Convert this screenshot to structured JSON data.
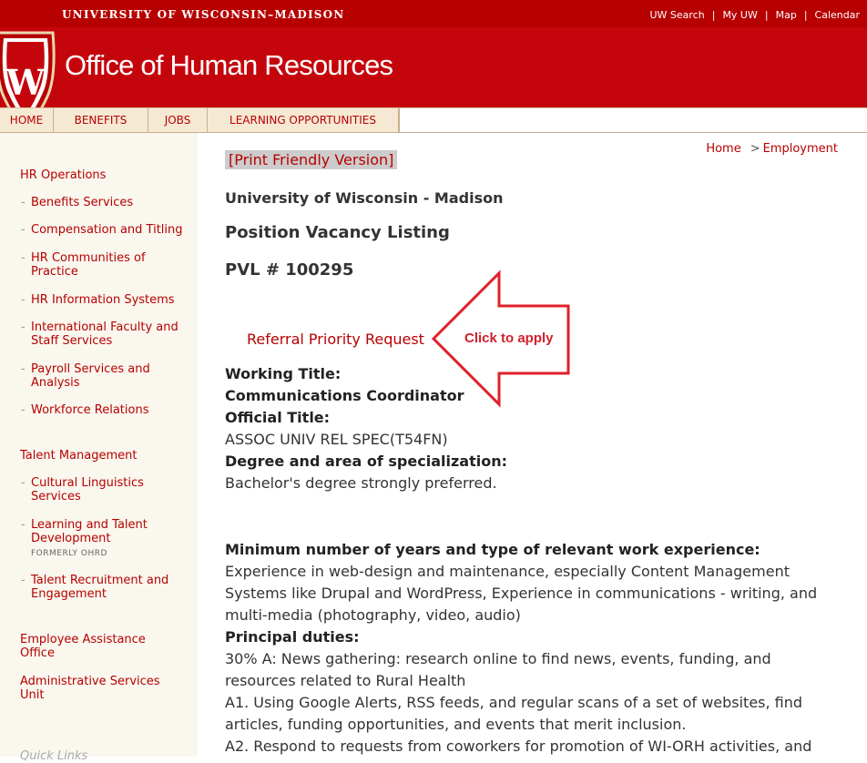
{
  "header": {
    "university": "UNIVERSITY OF WISCONSIN–MADISON",
    "office": "Office of Human Resources",
    "crest_letter": "W",
    "top_links": [
      "UW Search",
      "My UW",
      "Map",
      "Calendar"
    ]
  },
  "nav": {
    "tabs": [
      "HOME",
      "BENEFITS",
      "JOBS",
      "LEARNING OPPORTUNITIES"
    ]
  },
  "sidebar": {
    "hr_operations": "HR Operations",
    "hr_items": [
      "Benefits Services",
      "Compensation and Titling",
      "HR Communities of Practice",
      "HR Information Systems",
      "International Faculty and Staff Services",
      "Payroll Services and Analysis",
      "Workforce Relations"
    ],
    "talent_management": "Talent Management",
    "talent_items": [
      "Cultural Linguistics Services",
      "Learning and Talent Development",
      "Talent Recruitment and Engagement"
    ],
    "talent_note": "FORMERLY OHRD",
    "employee_assistance": "Employee Assistance Office",
    "administrative_services": "Administrative Services Unit",
    "quick_links": "Quick Links"
  },
  "breadcrumb": {
    "home": "Home",
    "gt": ">",
    "current": "Employment"
  },
  "content": {
    "print_label": "[Print Friendly Version]",
    "university_title": "University of Wisconsin - Madison",
    "listing_title": "Position Vacancy Listing",
    "pvl": "PVL # 100295",
    "referral_link": "Referral Priority Request",
    "click_to_apply": "Click to apply",
    "working_title_label": "Working Title:",
    "working_title": "Communications Coordinator",
    "official_title_label": "Official Title:",
    "official_title": "ASSOC UNIV REL SPEC(T54FN)",
    "degree_label": "Degree and area of specialization:",
    "degree": "Bachelor's degree strongly preferred.",
    "experience_label": "Minimum number of years and type of relevant work experience:",
    "experience": "Experience in web-design and maintenance, especially Content Management Systems like Drupal and WordPress, Experience in communications - writing, and multi-media (photography, video, audio)",
    "duties_label": "Principal duties:",
    "duty_a": "30% A: News gathering: research online to find news, events, funding, and resources related to Rural Health",
    "duty_a1": "A1. Using Google Alerts, RSS feeds, and regular scans of a set of websites, find articles, funding opportunities, and events that merit inclusion.",
    "duty_a2": "A2. Respond to requests from coworkers for promotion of WI-ORH activities, and"
  },
  "colors": {
    "brand_red": "#c5050c",
    "dark_red": "#b70101",
    "cta_red": "#d0202a"
  }
}
